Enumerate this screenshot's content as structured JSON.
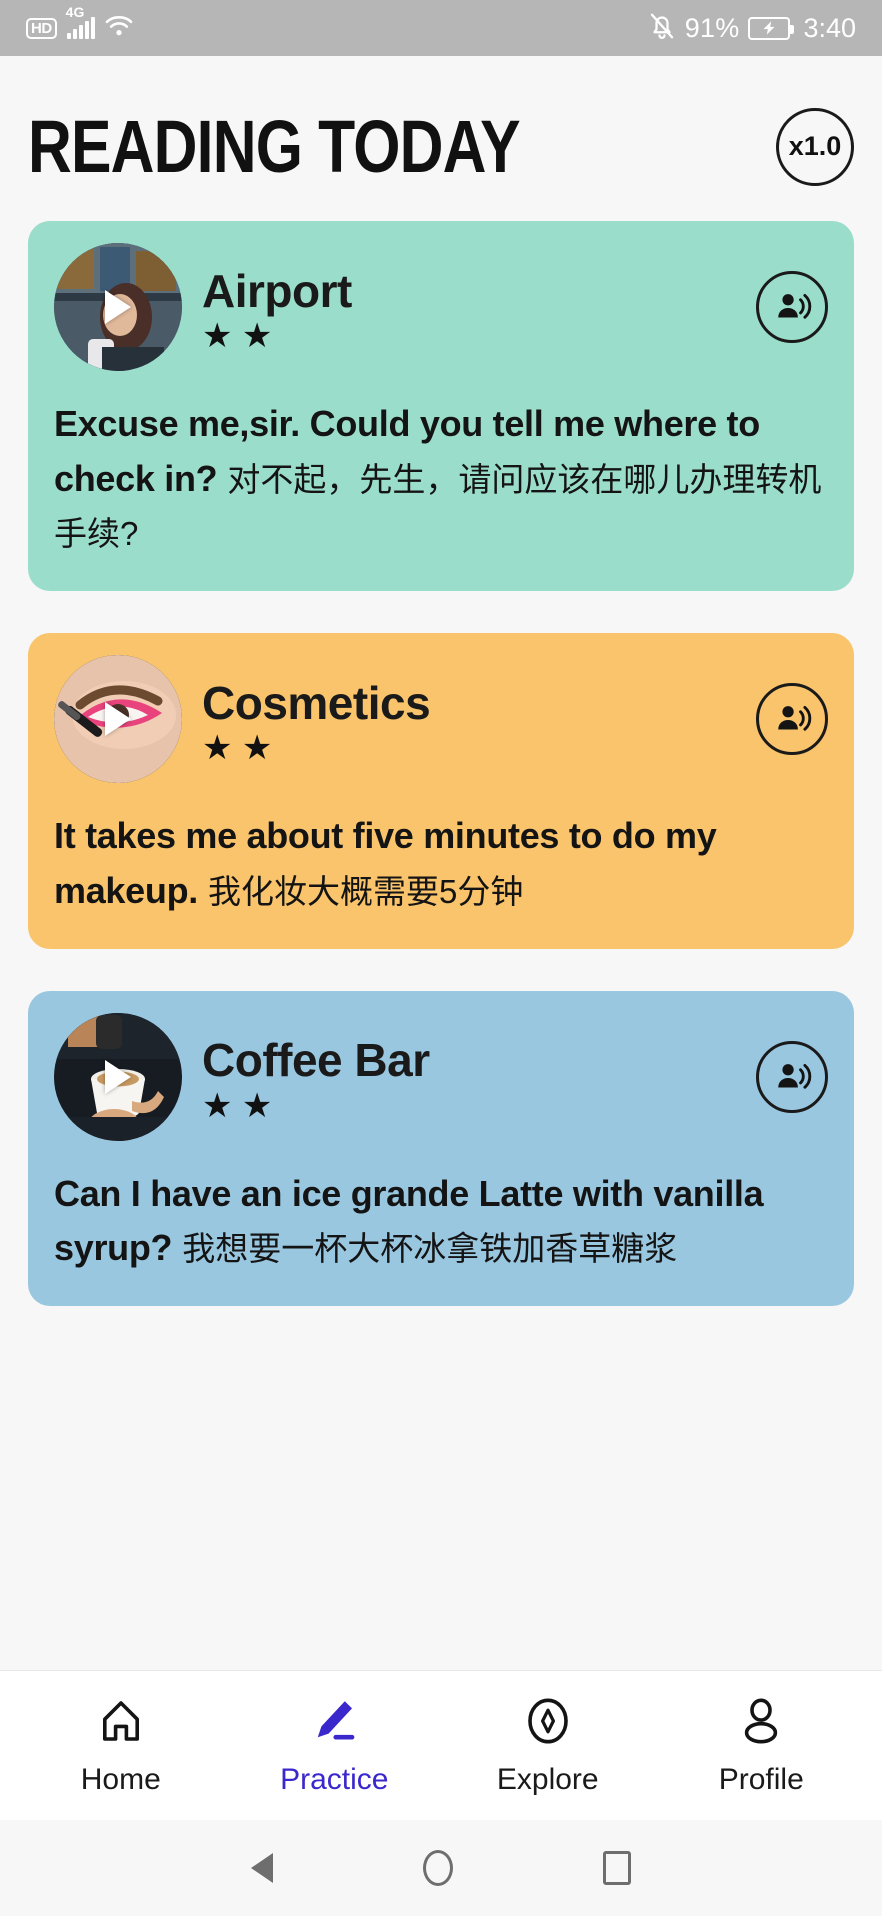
{
  "status_bar": {
    "hd_label": "HD",
    "network": "4G",
    "signal_icon": "signal-bars-icon",
    "wifi_icon": "wifi-icon",
    "silent_icon": "bell-muted-icon",
    "battery_percent": "91%",
    "battery_icon": "battery-charging-icon",
    "time": "3:40"
  },
  "header": {
    "title": "READING TODAY",
    "speed_badge": "x1.0"
  },
  "cards": [
    {
      "title": "Airport",
      "stars": "★ ★",
      "star_count": 2,
      "english": "Excuse me,sir. Could you tell me where to check in?",
      "chinese": "对不起，先生，请问应该在哪儿办理转机手续?",
      "bg_color": "#9BDDCB",
      "thumbnail": "airport-traveler-thumbnail",
      "play_icon": "play-icon",
      "speaker_icon": "person-speaking-icon"
    },
    {
      "title": "Cosmetics",
      "stars": "★ ★",
      "star_count": 2,
      "english": "It takes me about five minutes to do my makeup.",
      "chinese": "我化妆大概需要5分钟",
      "bg_color": "#F9C46B",
      "thumbnail": "eye-makeup-thumbnail",
      "play_icon": "play-icon",
      "speaker_icon": "person-speaking-icon"
    },
    {
      "title": "Coffee Bar",
      "stars": "★ ★",
      "star_count": 2,
      "english": "Can I have an ice grande Latte with vanilla syrup?",
      "chinese": "我想要一杯大杯冰拿铁加香草糖浆",
      "bg_color": "#9AC7E0",
      "thumbnail": "latte-pour-thumbnail",
      "play_icon": "play-icon",
      "speaker_icon": "person-speaking-icon"
    }
  ],
  "tabbar": {
    "active_color": "#3B28CC",
    "items": [
      {
        "label": "Home",
        "icon": "home-icon",
        "active": false
      },
      {
        "label": "Practice",
        "icon": "pencil-icon",
        "active": true
      },
      {
        "label": "Explore",
        "icon": "compass-icon",
        "active": false
      },
      {
        "label": "Profile",
        "icon": "person-icon",
        "active": false
      }
    ]
  },
  "android_nav": {
    "back": "back-triangle-icon",
    "home": "home-circle-icon",
    "recents": "recents-square-icon"
  }
}
